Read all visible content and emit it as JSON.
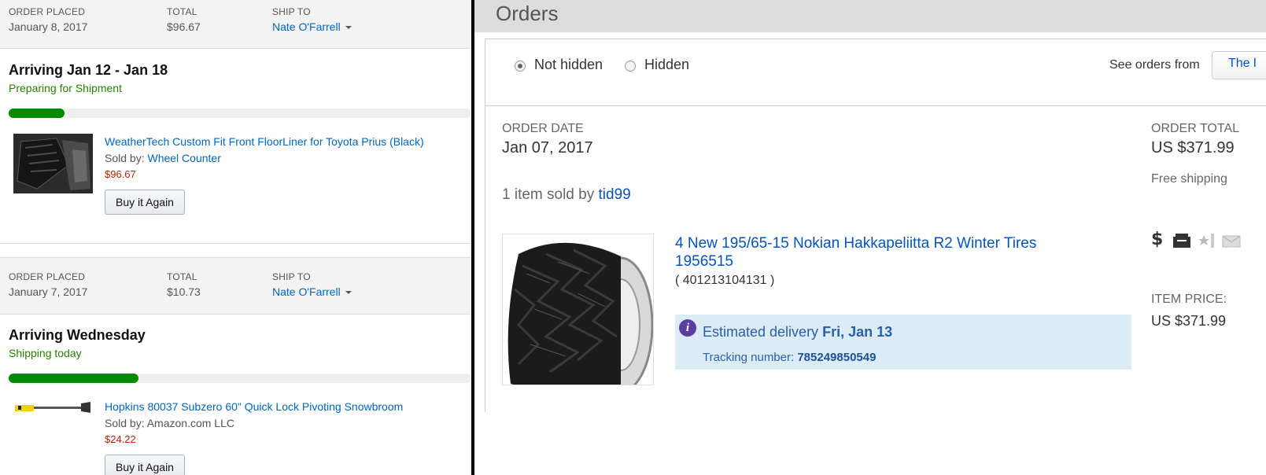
{
  "left_panel": {
    "orders": [
      {
        "order_placed_label": "ORDER PLACED",
        "order_placed_date": "January 8, 2017",
        "total_label": "TOTAL",
        "total_value": "$96.67",
        "ship_to_label": "SHIP TO",
        "ship_to_name": "Nate O'Farrell",
        "arriving": "Arriving Jan 12 - Jan 18",
        "status": "Preparing for Shipment",
        "progress_fraction": 0.12,
        "product_title": "WeatherTech Custom Fit Front FloorLiner for Toyota Prius (Black)",
        "sold_by_label": "Sold by:",
        "seller": "Wheel Counter",
        "price": "$96.67",
        "buy_again_label": "Buy it Again"
      },
      {
        "order_placed_label": "ORDER PLACED",
        "order_placed_date": "January 7, 2017",
        "total_label": "TOTAL",
        "total_value": "$10.73",
        "ship_to_label": "SHIP TO",
        "ship_to_name": "Nate O'Farrell",
        "arriving": "Arriving Wednesday",
        "status": "Shipping today",
        "progress_fraction": 0.28,
        "product_title": "Hopkins 80037 Subzero 60\" Quick Lock Pivoting Snowbroom",
        "sold_by_label": "Sold by:",
        "seller": "Amazon.com LLC",
        "price": "$24.22",
        "buy_again_label": "Buy it Again"
      }
    ]
  },
  "right_panel": {
    "title": "Orders",
    "filter": {
      "not_hidden_label": "Not hidden",
      "hidden_label": "Hidden",
      "selected": "not_hidden",
      "see_orders_from_label": "See orders from",
      "see_orders_from_value": "The l"
    },
    "order": {
      "order_date_label": "ORDER DATE",
      "order_date": "Jan 07, 2017",
      "order_total_label": "ORDER TOTAL",
      "order_total": "US $371.99",
      "shipping": "Free shipping",
      "items_sold_text": "1 item sold by",
      "seller": "tid99",
      "item_title": "4 New 195/65-15 Nokian Hakkapeliitta R2 Winter Tires 1956515",
      "item_number": "( 401213104131 )",
      "estimated_label": "Estimated delivery",
      "estimated_date": "Fri, Jan 13",
      "tracking_label": "Tracking number:",
      "tracking_number": "785249850549",
      "item_price_label": "ITEM PRICE:",
      "item_price": "US $371.99",
      "status_icons": [
        "dollar-icon",
        "box-icon",
        "star-feedback-icon",
        "envelope-icon"
      ]
    }
  },
  "colors": {
    "link_blue_left": "#0066c0",
    "link_blue_right": "#0654ba",
    "status_green": "#2a8000",
    "progress_green": "#008a00",
    "price_red": "#b12704",
    "info_bg": "#dbecf7"
  }
}
